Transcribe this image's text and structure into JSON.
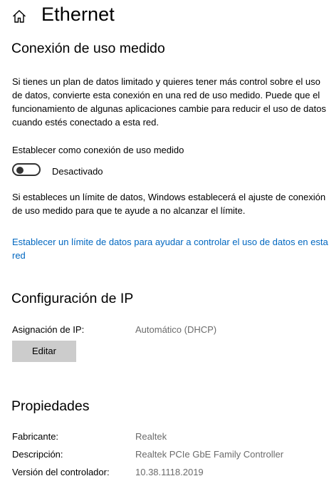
{
  "header": {
    "title": "Ethernet",
    "home_icon": "home-icon"
  },
  "metered": {
    "heading": "Conexión de uso medido",
    "description": "Si tienes un plan de datos limitado y quieres tener más control sobre el uso de datos, convierte esta conexión en una red de uso medido. Puede que el funcionamiento de algunas aplicaciones cambie para reducir el uso de datos cuando estés conectado a esta red.",
    "toggle_label": "Establecer como conexión de uso medido",
    "toggle_state": "Desactivado",
    "toggle_on": false,
    "limit_info": "Si estableces un límite de datos, Windows establecerá el ajuste de conexión de uso medido para que te ayude a no alcanzar el límite.",
    "limit_link": "Establecer un límite de datos para ayudar a controlar el uso de datos en esta red"
  },
  "ip": {
    "heading": "Configuración de IP",
    "assignment_label": "Asignación de IP:",
    "assignment_value": "Automático (DHCP)",
    "edit_button": "Editar"
  },
  "properties": {
    "heading": "Propiedades",
    "rows": [
      {
        "label": "Fabricante:",
        "value": "Realtek"
      },
      {
        "label": "Descripción:",
        "value": "Realtek PCIe GbE Family Controller"
      },
      {
        "label": "Versión del controlador:",
        "value": "10.38.1118.2019"
      }
    ]
  },
  "colors": {
    "link": "#0067c0",
    "value_text": "#6b6b6b",
    "button_bg": "#cccccc"
  }
}
